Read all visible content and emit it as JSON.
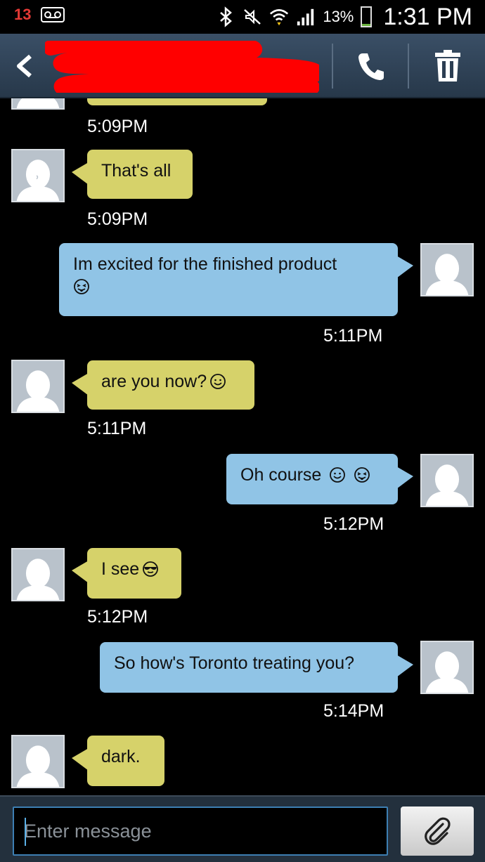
{
  "status_bar": {
    "missed_calls": "13",
    "battery_percent": "13%",
    "battery_level": 0.13,
    "time": "1:31 PM",
    "icons": [
      "missed-call-icon",
      "voicemail-icon",
      "bluetooth-icon",
      "mute-icon",
      "wifi-icon",
      "signal-icon",
      "battery-icon"
    ]
  },
  "header": {
    "contact_name": "",
    "actions": [
      "back-icon",
      "phone-icon",
      "trash-icon"
    ]
  },
  "messages": [
    {
      "direction": "in",
      "text": "That's all",
      "time": "5:09PM",
      "emoji": []
    },
    {
      "direction": "out",
      "text": "Im excited for the finished product",
      "time": "5:11PM",
      "emoji": [
        "tongue-wink-emoji"
      ]
    },
    {
      "direction": "in",
      "text": "are you now?",
      "time": "5:11PM",
      "emoji": [
        "smile-emoji"
      ]
    },
    {
      "direction": "out",
      "text": "Oh course",
      "time": "5:12PM",
      "emoji": [
        "smile-emoji",
        "tongue-wink-emoji"
      ]
    },
    {
      "direction": "in",
      "text": "I see",
      "time": "5:12PM",
      "emoji": [
        "sunglasses-emoji"
      ]
    },
    {
      "direction": "out",
      "text": "So how's Toronto treating you?",
      "time": "5:14PM",
      "emoji": []
    },
    {
      "direction": "in",
      "text": "dark.",
      "time": "",
      "emoji": []
    }
  ],
  "previous_time": "5:09PM",
  "composer": {
    "placeholder": "Enter message",
    "value": ""
  },
  "colors": {
    "incoming_bubble": "#d6d26a",
    "outgoing_bubble": "#90c4e6",
    "action_bar": "#2f4257",
    "redaction": "#ff0000"
  }
}
